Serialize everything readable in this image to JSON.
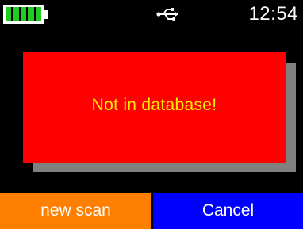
{
  "status_bar": {
    "battery_level": 1.0,
    "battery_cells": 5,
    "battery_color": "#22cc22",
    "connection_icon": "usb-icon",
    "time": "12:54"
  },
  "dialog": {
    "message": "Not in database!",
    "background_color": "#ff0000",
    "text_color": "#ffee00"
  },
  "buttons": {
    "new_scan": {
      "label": "new scan",
      "color": "#ff7f00"
    },
    "cancel": {
      "label": "Cancel",
      "color": "#0000ff"
    }
  }
}
